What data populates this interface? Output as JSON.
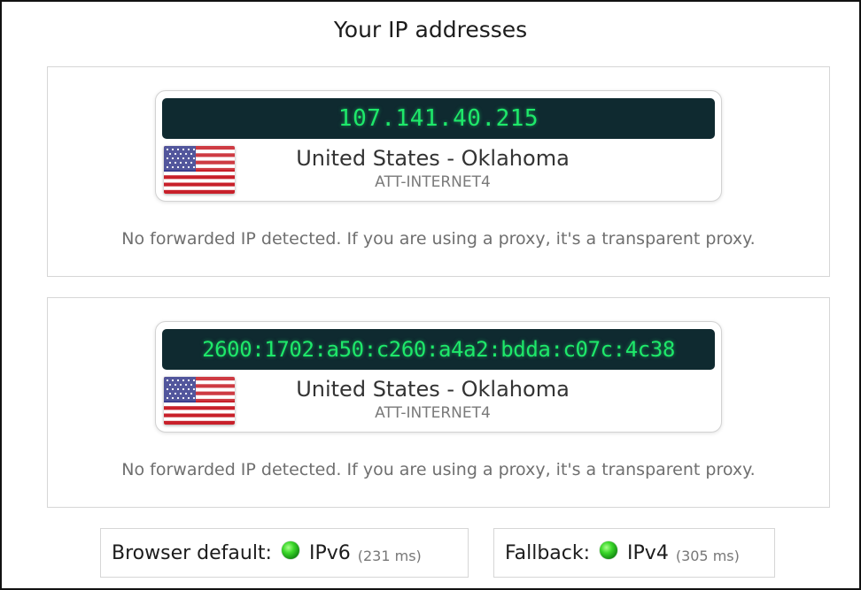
{
  "title": "Your IP addresses",
  "ipv4": {
    "address": "107.141.40.215",
    "location": "United States - Oklahoma",
    "isp": "ATT-INTERNET4",
    "note": "No forwarded IP detected. If you are using a proxy, it's a transparent proxy.",
    "flag": "us-flag-icon"
  },
  "ipv6": {
    "address": "2600:1702:a50:c260:a4a2:bdda:c07c:4c38",
    "location": "United States - Oklahoma",
    "isp": "ATT-INTERNET4",
    "note": "No forwarded IP detected. If you are using a proxy, it's a transparent proxy.",
    "flag": "us-flag-icon"
  },
  "browser_default": {
    "label": "Browser default:",
    "protocol": "IPv6",
    "latency": "(231 ms)",
    "indicator_color": "#3bd72a"
  },
  "fallback": {
    "label": "Fallback:",
    "protocol": "IPv4",
    "latency": "(305 ms)",
    "indicator_color": "#3bd72a"
  },
  "colors": {
    "ip_bar_background": "#0f2a30",
    "ip_text": "#1ee86a"
  }
}
